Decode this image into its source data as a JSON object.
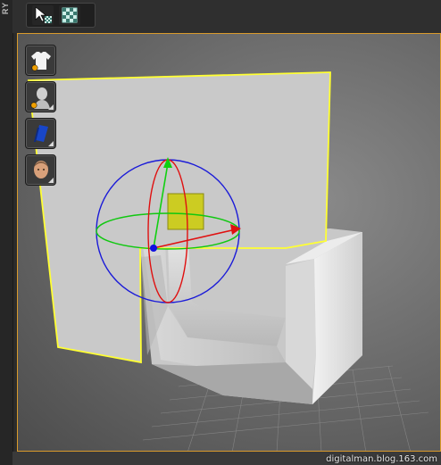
{
  "panel": {
    "edge_label": "RY"
  },
  "toolbar": {
    "items": [
      {
        "name": "select-object-tool",
        "icon": "cursor-checker-icon"
      },
      {
        "name": "checker-material-tool",
        "icon": "checker-grid-icon"
      }
    ]
  },
  "viewport": {
    "border_color": "#d99a2b",
    "selection_color": "#ffff33",
    "gizmo": {
      "x_axis": "#e01010",
      "y_axis": "#10d010",
      "z_axis": "#1010e0"
    }
  },
  "side_buttons": [
    {
      "name": "garment-button",
      "icon": "tshirt-icon"
    },
    {
      "name": "avatar-button",
      "icon": "avatar-head-icon"
    },
    {
      "name": "fabric-button",
      "icon": "fabric-icon"
    },
    {
      "name": "skin-button",
      "icon": "face-icon"
    }
  ],
  "watermark": "digitalman.blog.163.com"
}
